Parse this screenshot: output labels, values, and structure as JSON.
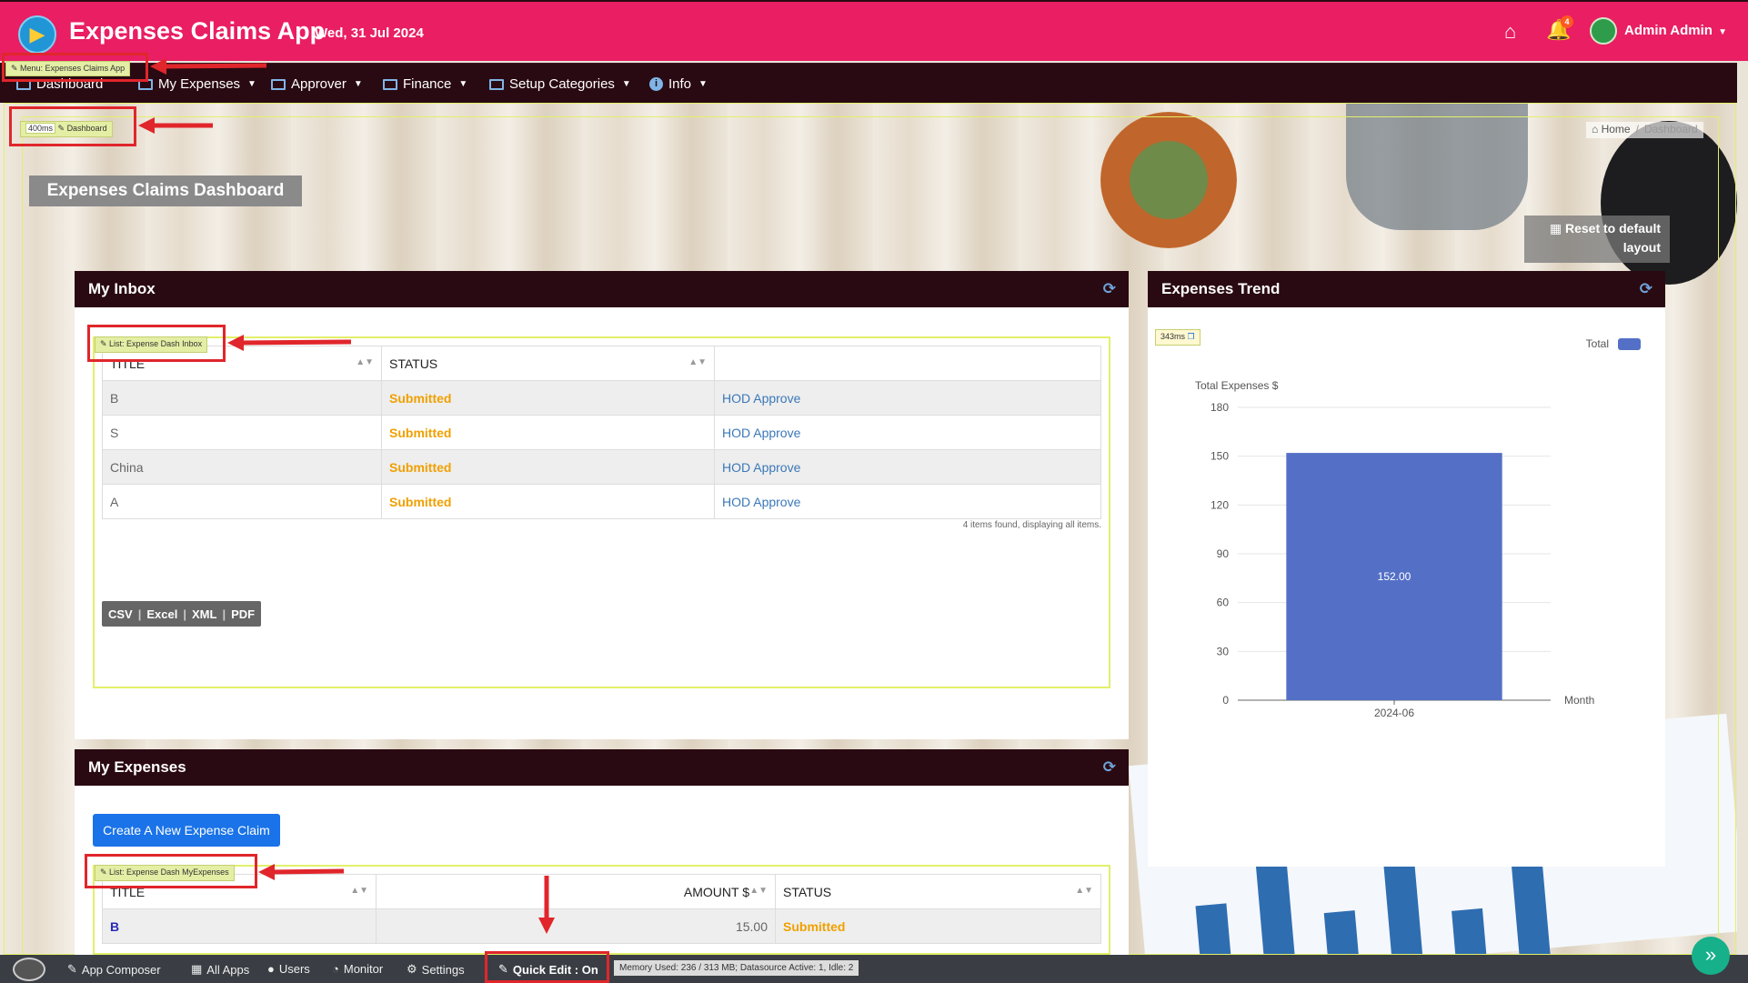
{
  "header": {
    "title": "Expenses Claims App",
    "date": "Wed, 31 Jul 2024",
    "notification_count": "4",
    "user": "Admin Admin"
  },
  "nav": {
    "items": [
      {
        "label": "Dashboard"
      },
      {
        "label": "My Expenses"
      },
      {
        "label": "Approver"
      },
      {
        "label": "Finance"
      },
      {
        "label": "Setup Categories"
      },
      {
        "label": "Info"
      }
    ]
  },
  "quick_edit": {
    "menu_tag": "Menu: Expenses Claims App",
    "page_timing": "400ms",
    "page_tag": "Dashboard",
    "inbox_tag": "List: Expense Dash Inbox",
    "chart_timing": "343ms",
    "myexp_tag": "List: Expense Dash MyExpenses"
  },
  "breadcrumb": {
    "home": "Home",
    "current": "Dashboard"
  },
  "page": {
    "title": "Expenses Claims Dashboard",
    "reset_label": "Reset to default layout"
  },
  "inbox": {
    "title": "My Inbox",
    "columns": [
      "TITLE",
      "STATUS",
      ""
    ],
    "rows": [
      {
        "title": "B",
        "status": "Submitted",
        "action": "HOD Approve"
      },
      {
        "title": "S",
        "status": "Submitted",
        "action": "HOD Approve"
      },
      {
        "title": "China",
        "status": "Submitted",
        "action": "HOD Approve"
      },
      {
        "title": "A",
        "status": "Submitted",
        "action": "HOD Approve"
      }
    ],
    "count_text": "4 items found, displaying all items.",
    "exports": [
      "CSV",
      "Excel",
      "XML",
      "PDF"
    ]
  },
  "trend": {
    "title": "Expenses Trend"
  },
  "chart_data": {
    "type": "bar",
    "categories": [
      "2024-06"
    ],
    "series": [
      {
        "name": "Total",
        "values": [
          152.0
        ],
        "color": "#5470c6"
      }
    ],
    "data_labels": [
      "152.00"
    ],
    "ylabel": "Total Expenses $",
    "xlabel": "Month",
    "yticks": [
      0,
      30,
      60,
      90,
      120,
      150,
      180
    ],
    "ylim": [
      0,
      180
    ],
    "grid": true,
    "legend": "top-right"
  },
  "my_expenses": {
    "title": "My Expenses",
    "create_label": "Create A New Expense Claim",
    "columns": [
      "TITLE",
      "AMOUNT $",
      "STATUS"
    ],
    "rows": [
      {
        "title": "B",
        "amount": "15.00",
        "status": "Submitted"
      }
    ]
  },
  "footer": {
    "app_composer": "App Composer",
    "all_apps": "All Apps",
    "users": "Users",
    "monitor": "Monitor",
    "settings": "Settings",
    "quick_edit": "Quick Edit : On",
    "memory": "Memory Used: 236 / 313 MB; Datasource Active: 1, Idle: 2"
  },
  "colors": {
    "header": "#e91e63",
    "nav": "#2a0a12",
    "accent_blue": "#1a73e8",
    "submitted": "#f0a000",
    "bar": "#5470c6"
  }
}
